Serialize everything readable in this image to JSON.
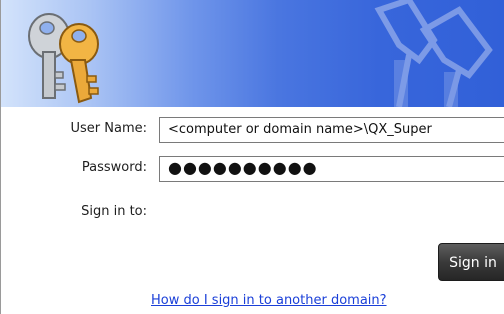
{
  "banner": {
    "icon": "keys-icon",
    "watermark_icon": "keys-watermark-icon",
    "gradient_start": "#d3e3fb",
    "gradient_end": "#3160d8"
  },
  "form": {
    "username_label": "User Name:",
    "username_value": "<computer or domain name>\\QX_Super",
    "password_label": "Password:",
    "password_value": "●●●●●●●●●●",
    "signin_to_label": "Sign in to:"
  },
  "actions": {
    "signin_button_label": "Sign in",
    "help_link_text": "How do I sign in to another domain?"
  },
  "colors": {
    "link": "#1a3fd8",
    "button_bg": "#3a3a3a"
  }
}
